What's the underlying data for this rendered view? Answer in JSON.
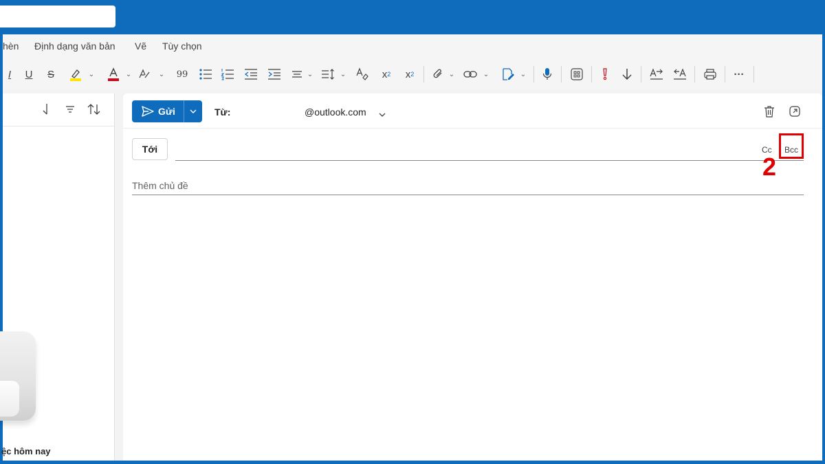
{
  "ribbon": {
    "tabs": [
      "hèn",
      "Định dạng văn bản",
      "Vẽ",
      "Tùy chọn"
    ]
  },
  "toolbar": {
    "italic": "I",
    "underline": "U",
    "strikethrough": "S",
    "quote": "99",
    "subscript": "x",
    "subscript_mark": "2",
    "superscript": "x",
    "superscript_mark": "2",
    "more": "···",
    "accent_colors": {
      "highlight": "#ffe600",
      "font_color": "#c50f1f",
      "mic": "#0f6cbd",
      "importance": "#c50f1f"
    }
  },
  "left_pane": {
    "caption": "ệc hôm nay"
  },
  "compose": {
    "send_label": "Gửi",
    "from_label": "Từ:",
    "from_value": "@outlook.com",
    "to_label": "Tới",
    "cc_label": "Cc",
    "bcc_label": "Bcc",
    "subject_placeholder": "Thêm chủ đề"
  },
  "annotation": {
    "step": "2",
    "color": "#e00000"
  }
}
